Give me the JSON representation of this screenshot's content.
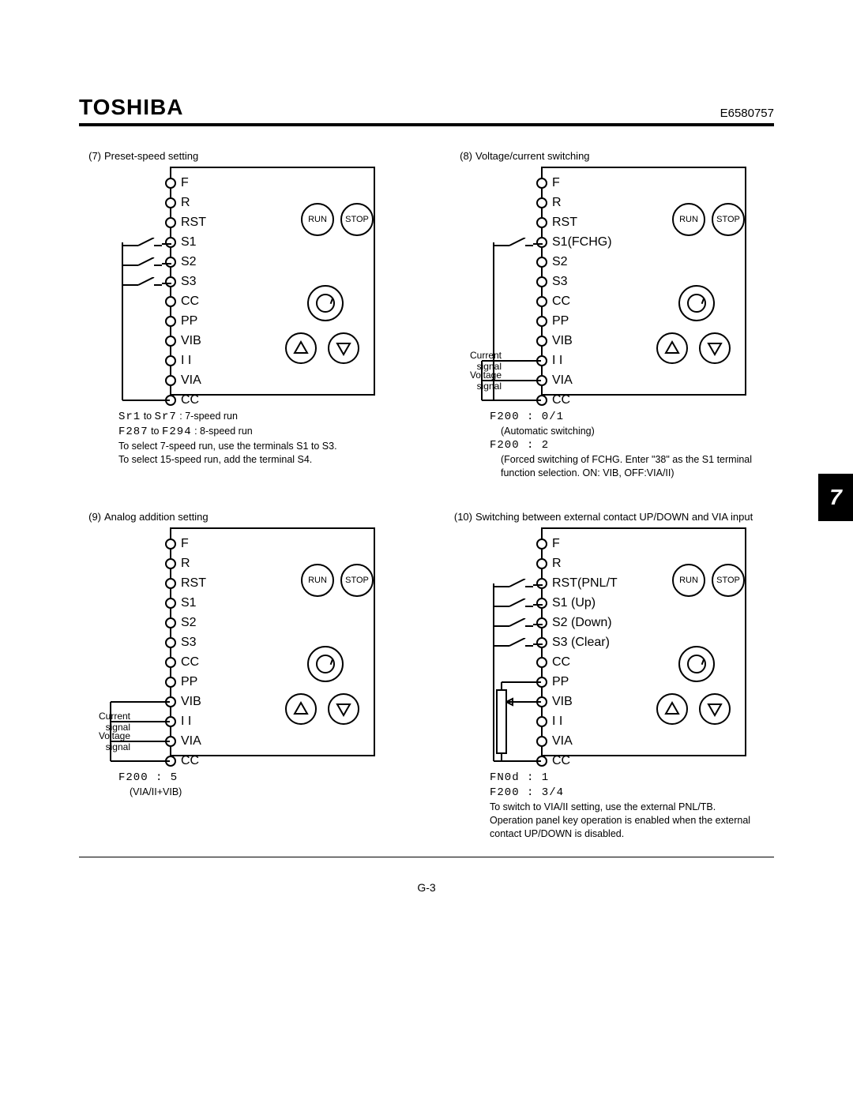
{
  "header": {
    "brand": "TOSHIBA",
    "doc_id": "E6580757"
  },
  "side_tab": "7",
  "footer": "G-3",
  "common": {
    "run_label": "RUN",
    "stop_label": "STOP"
  },
  "diagrams": [
    {
      "number": "(7)",
      "title": "Preset-speed setting",
      "terminals": [
        "F",
        "R",
        "RST",
        "S1",
        "S2",
        "S3",
        "CC",
        "PP",
        "VIB",
        "I I",
        "VIA",
        "CC"
      ],
      "switch_targets": [
        "S1",
        "S2",
        "S3"
      ],
      "switch_common_to": "CC",
      "left_labels": [],
      "notes_segments": [
        {
          "seg": "Sr1",
          "mid": " to ",
          "seg2": "Sr7",
          "tail": " : 7-speed run"
        },
        {
          "seg": "F287",
          "mid": " to ",
          "seg2": "F294",
          "tail": " : 8-speed run"
        }
      ],
      "notes_plain": [
        "To select 7-speed run, use the terminals S1 to S3.",
        "To select 15-speed run, add the terminal S4."
      ]
    },
    {
      "number": "(8)",
      "title": "Voltage/current switching",
      "terminals": [
        "F",
        "R",
        "RST",
        "S1(FCHG)",
        "S2",
        "S3",
        "CC",
        "PP",
        "VIB",
        "I I",
        "VIA",
        "CC"
      ],
      "switch_targets": [
        "S1(FCHG)"
      ],
      "switch_common_to": "CC",
      "left_labels": [
        {
          "text": "Current signal",
          "at": "I I"
        },
        {
          "text": "Voltage signal",
          "at": "VIA"
        }
      ],
      "left_wires_to": [
        "I I",
        "VIA",
        "CC"
      ],
      "param_lines": [
        {
          "seg": "F200 : 0/1",
          "plain": "(Automatic switching)"
        },
        {
          "seg": "F200 : 2",
          "plain": "(Forced switching of FCHG. Enter \"38\" as the S1 terminal function selection. ON: VIB, OFF:VIA/II)"
        }
      ]
    },
    {
      "number": "(9)",
      "title": "Analog addition setting",
      "terminals": [
        "F",
        "R",
        "RST",
        "S1",
        "S2",
        "S3",
        "CC",
        "PP",
        "VIB",
        "I I",
        "VIA",
        "CC"
      ],
      "switch_targets": [],
      "left_labels": [
        {
          "text": "Current signal",
          "at": "I I"
        },
        {
          "text": "Voltage signal",
          "at": "VIA"
        }
      ],
      "left_wires_to": [
        "VIB",
        "I I",
        "VIA",
        "CC"
      ],
      "param_lines": [
        {
          "seg": "F200 : 5",
          "plain": "(VIA/II+VIB)"
        }
      ]
    },
    {
      "number": "(10)",
      "title": "Switching between external contact UP/DOWN and VIA input",
      "terminals": [
        "F",
        "R",
        "RST(PNL/T",
        "S1 (Up)",
        "S2 (Down)",
        "S3 (Clear)",
        "CC",
        "PP",
        "VIB",
        "I I",
        "VIA",
        "CC"
      ],
      "switch_targets": [
        "RST(PNL/T",
        "S1 (Up)",
        "S2 (Down)",
        "S3 (Clear)"
      ],
      "switch_common_to": "CC",
      "left_labels": [],
      "left_pot_between": [
        "PP",
        "VIB",
        "CC"
      ],
      "param_lines": [
        {
          "seg": "FN0d : 1",
          "plain": ""
        },
        {
          "seg": "F200 : 3/4",
          "plain": ""
        }
      ],
      "notes_plain": [
        "To switch to VIA/II setting, use the external PNL/TB.",
        "Operation panel key operation is enabled when the external contact UP/DOWN is disabled."
      ]
    }
  ]
}
